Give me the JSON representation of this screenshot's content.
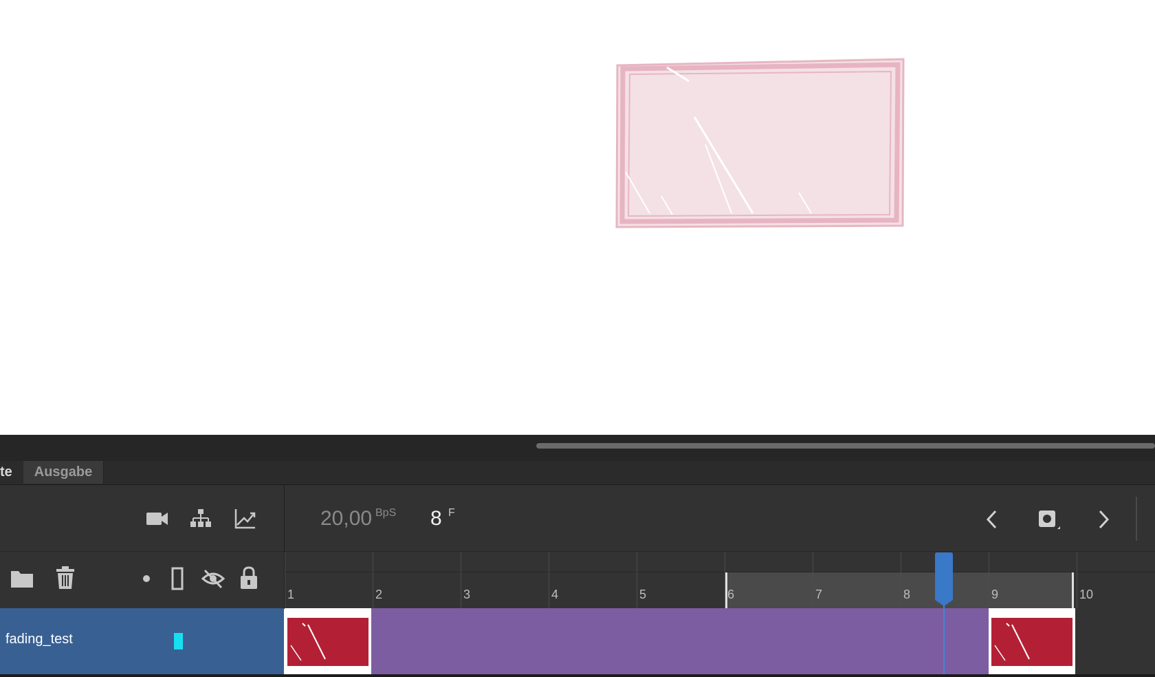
{
  "stage": {
    "shape_fill": "#f4e1e5",
    "shape_stroke": "#e4aebd"
  },
  "tabs": {
    "active_partial": "te",
    "output": "Ausgabe"
  },
  "timeline": {
    "fps_value": "20,00",
    "fps_unit": "BpS",
    "current_frame": "8",
    "frame_unit": "F",
    "frame_numbers": [
      "1",
      "2",
      "3",
      "4",
      "5",
      "6",
      "7",
      "8",
      "9",
      "10"
    ],
    "playhead_frame": 8
  },
  "layer": {
    "name": "fading_test",
    "color": "#16e0f0"
  },
  "icons": {
    "camera": "camera-icon",
    "hierarchy": "hierarchy-icon",
    "graph": "easing-graph-icon",
    "prev": "chevron-left-icon",
    "keyframe": "insert-keyframe-icon",
    "next": "chevron-right-icon",
    "folder": "folder-icon",
    "trash": "trash-icon",
    "dot": "dot-icon",
    "outline": "outline-icon",
    "eye": "hidden-eye-icon",
    "lock": "lock-icon"
  },
  "colors": {
    "tween": "#7c5da2",
    "keyframe": "#b32036",
    "playhead": "#3a78c8",
    "layer_row": "#386093"
  }
}
